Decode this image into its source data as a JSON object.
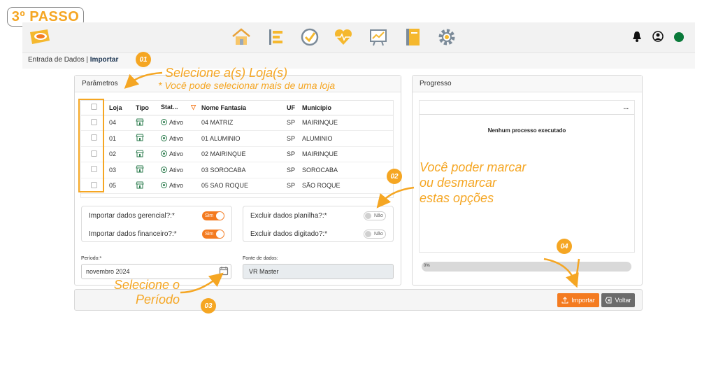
{
  "step": "3º PASSO",
  "breadcrumb": {
    "section": "Entrada de Dados |",
    "current": "Importar"
  },
  "parametros": {
    "title": "Parâmetros",
    "columns": [
      "Loja",
      "Tipo",
      "Stat...",
      "Nome Fantasia",
      "UF",
      "Município"
    ],
    "rows": [
      {
        "loja": "04",
        "status": "Ativo",
        "nome": "04 MATRIZ",
        "uf": "SP",
        "municipio": "MAIRINQUE"
      },
      {
        "loja": "01",
        "status": "Ativo",
        "nome": "01 ALUMINIO",
        "uf": "SP",
        "municipio": "ALUMINIO"
      },
      {
        "loja": "02",
        "status": "Ativo",
        "nome": "02 MAIRINQUE",
        "uf": "SP",
        "municipio": "MAIRINQUE"
      },
      {
        "loja": "03",
        "status": "Ativo",
        "nome": "03 SOROCABA",
        "uf": "SP",
        "municipio": "SOROCABA"
      },
      {
        "loja": "05",
        "status": "Ativo",
        "nome": "05 SAO ROQUE",
        "uf": "SP",
        "municipio": "SÃO ROQUE"
      }
    ],
    "options_left": [
      {
        "label": "Importar dados gerencial?:*",
        "toggle": "Sim"
      },
      {
        "label": "Importar dados financeiro?:*",
        "toggle": "Sim"
      }
    ],
    "options_right": [
      {
        "label": "Excluir dados planilha?:*",
        "toggle": "Não"
      },
      {
        "label": "Excluir dados digitado?:*",
        "toggle": "Não"
      }
    ],
    "periodo": {
      "label": "Período:*",
      "value": "novembro 2024"
    },
    "fonte": {
      "label": "Fonte de dados:",
      "value": "VR Master"
    }
  },
  "progresso": {
    "title": "Progresso",
    "menu": "...",
    "empty": "Nenhum processo executado",
    "percent_label": "0%",
    "progress": 0
  },
  "footer": {
    "importar": "Importar",
    "voltar": "Voltar"
  },
  "annotations": {
    "n01": "01",
    "a1_line1": "Selecione a(s) Loja(s)",
    "a1_line2": "* Você pode selecionar mais de uma loja",
    "n02": "02",
    "a2_line1": "Você poder marcar",
    "a2_line2": "ou desmarcar",
    "a2_line3": "estas opções",
    "n03": "03",
    "a3_line1": "Selecione o",
    "a3_line2": "Período",
    "n04": "04"
  },
  "colors": {
    "accent": "#f47b20",
    "annotation": "#f5a623",
    "status": "#2e7d4f",
    "online": "#0a7a3a"
  }
}
